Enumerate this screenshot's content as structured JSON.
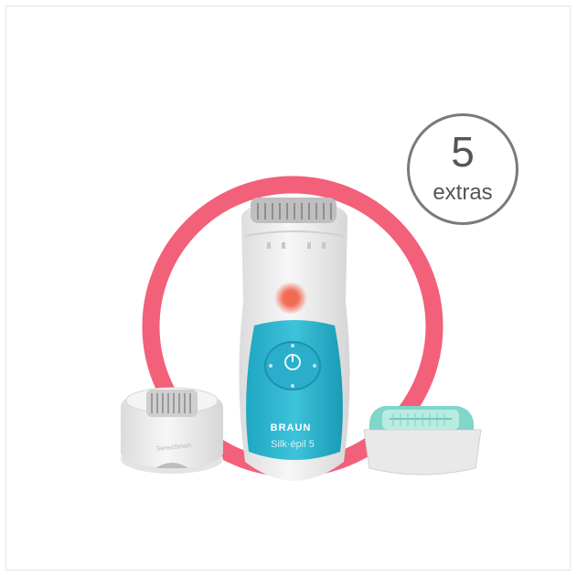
{
  "badge": {
    "number": "5",
    "text": "extras"
  },
  "product": {
    "brand": "BRAUN",
    "model": "Silk·épil 5",
    "cap_label": "SensoSmart"
  },
  "colors": {
    "ring": "#f2607a",
    "body_blue": "#2bb5cf",
    "body_white": "#eeeeee",
    "light": "#f26a52",
    "shaver_accent": "#7fd6c9",
    "badge_border": "#7a7a7a"
  }
}
